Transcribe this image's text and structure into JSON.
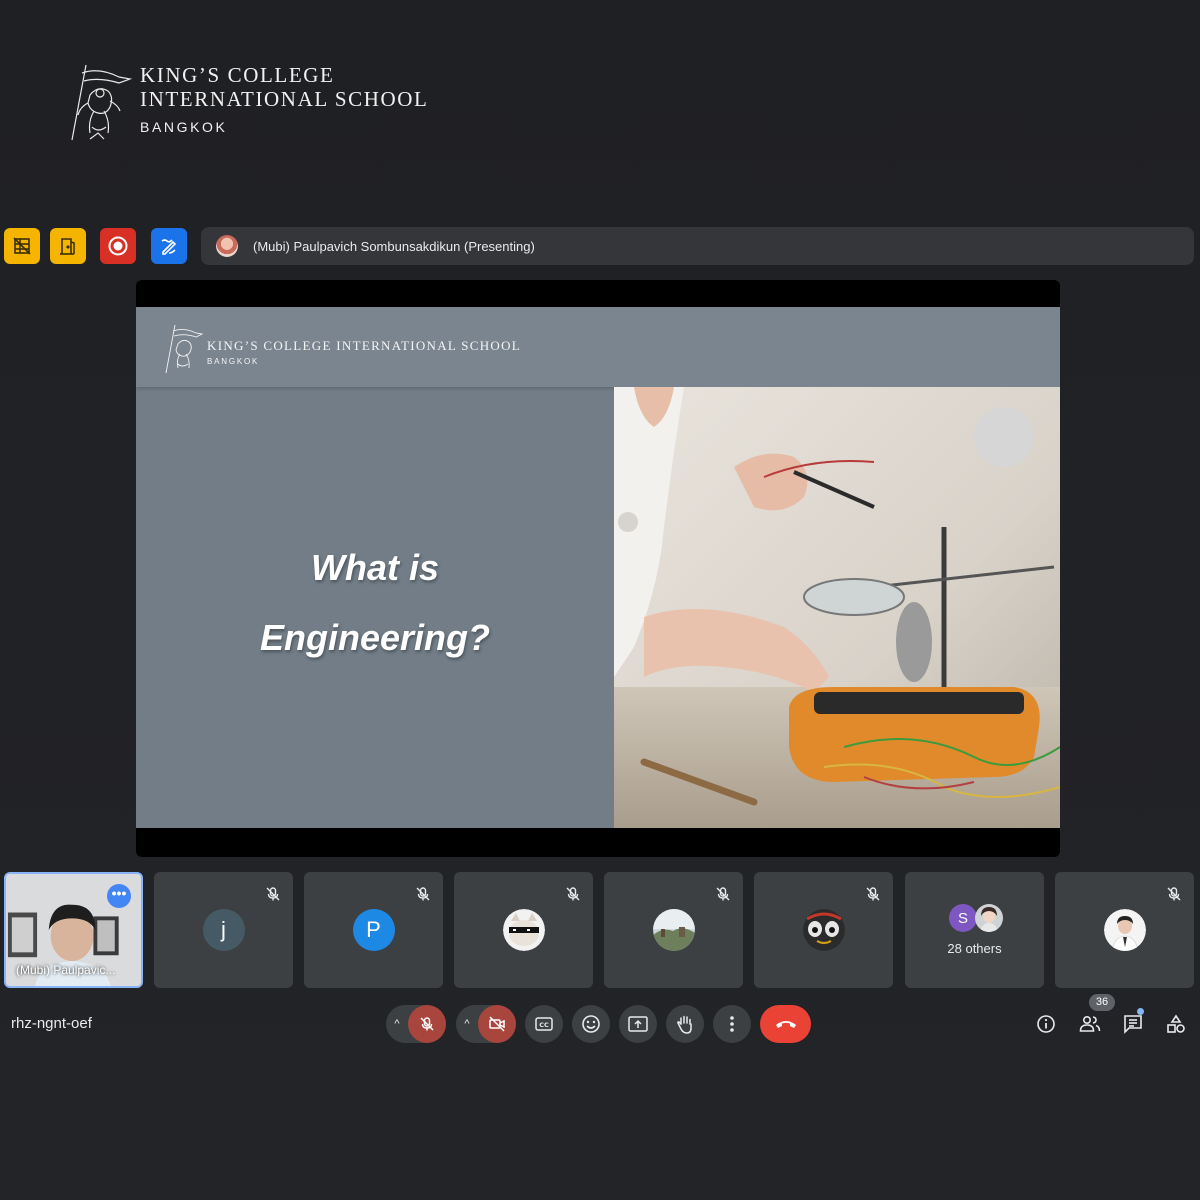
{
  "branding": {
    "line1": "KING’S COLLEGE",
    "line2": "INTERNATIONAL SCHOOL",
    "line3": "BANGKOK"
  },
  "toolbar": {
    "extensions": [
      {
        "icon": "grid-off-icon",
        "color": "#f4b400"
      },
      {
        "icon": "door-icon",
        "color": "#f4b400"
      },
      {
        "icon": "record-icon",
        "color": "#d93025"
      },
      {
        "icon": "pen-sparkle-icon",
        "color": "#1a73e8"
      }
    ],
    "presenting_text": "(Mubi) Paulpavich Sombunsakdikun (Presenting)"
  },
  "slide": {
    "header_brand": "KING’S COLLEGE INTERNATIONAL SCHOOL",
    "header_sub": "BANGKOK",
    "title_line1": "What is",
    "title_line2": "Engineering?",
    "image": "woman-soldering-electronics-photo"
  },
  "participants": [
    {
      "name": "(Mubi) Paulpavic...",
      "type": "self-video"
    },
    {
      "initial": "j",
      "color": "#455a64",
      "muted": true
    },
    {
      "initial": "P",
      "color": "#1e88e5",
      "muted": true
    },
    {
      "avatar": "cat-sunglasses-avatar",
      "muted": true
    },
    {
      "avatar": "landscape-avatar",
      "muted": true
    },
    {
      "avatar": "character-avatar",
      "muted": true
    },
    {
      "others_label": "28 others",
      "initial": "S",
      "color": "#7e57c2"
    },
    {
      "avatar": "person-avatar",
      "muted": true
    }
  ],
  "controls": {
    "meeting_code": "rhz-ngnt-oef",
    "participant_count": "36",
    "end_call_color": "#ea4335"
  }
}
